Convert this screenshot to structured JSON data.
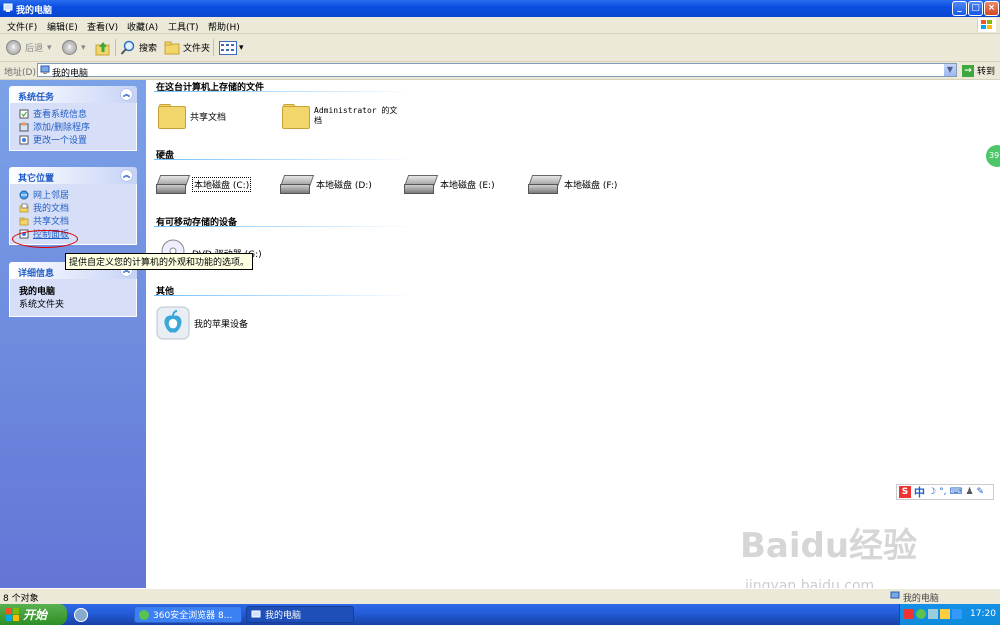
{
  "window": {
    "title": "我的电脑"
  },
  "menu": [
    "文件(F)",
    "编辑(E)",
    "查看(V)",
    "收藏(A)",
    "工具(T)",
    "帮助(H)"
  ],
  "toolbar": {
    "back": "后退",
    "search": "搜索",
    "folders": "文件夹"
  },
  "address": {
    "label": "地址(D)",
    "value": "我的电脑",
    "go": "转到"
  },
  "sidebar": {
    "system_tasks": {
      "title": "系统任务",
      "items": [
        "查看系统信息",
        "添加/删除程序",
        "更改一个设置"
      ]
    },
    "other_places": {
      "title": "其它位置",
      "items": [
        "网上邻居",
        "我的文档",
        "共享文档",
        "控制面板"
      ]
    },
    "details": {
      "title": "详细信息",
      "name": "我的电脑",
      "desc": "系统文件夹"
    }
  },
  "tooltip": "提供自定义您的计算机的外观和功能的选项。",
  "sections": {
    "stored": {
      "title": "在这台计算机上存储的文件",
      "items": [
        "共享文档",
        "Administrator 的文",
        "档"
      ]
    },
    "drives": {
      "title": "硬盘",
      "items": [
        "本地磁盘 (C:)",
        "本地磁盘 (D:)",
        "本地磁盘 (E:)",
        "本地磁盘 (F:)"
      ]
    },
    "removable": {
      "title": "有可移动存储的设备",
      "items": [
        "DVD 驱动器 (G:)"
      ]
    },
    "other": {
      "title": "其他",
      "items": [
        "我的苹果设备"
      ]
    }
  },
  "status": {
    "left": "8 个对象",
    "right": "我的电脑"
  },
  "taskbar": {
    "start": "开始",
    "tasks": [
      "360安全浏览器 8...",
      "我的电脑"
    ],
    "clock": "17:20"
  },
  "ime": {
    "label": "中"
  },
  "badge": "39",
  "watermark": {
    "logo": "Baidu经验",
    "url": "jingyan.baidu.com"
  }
}
